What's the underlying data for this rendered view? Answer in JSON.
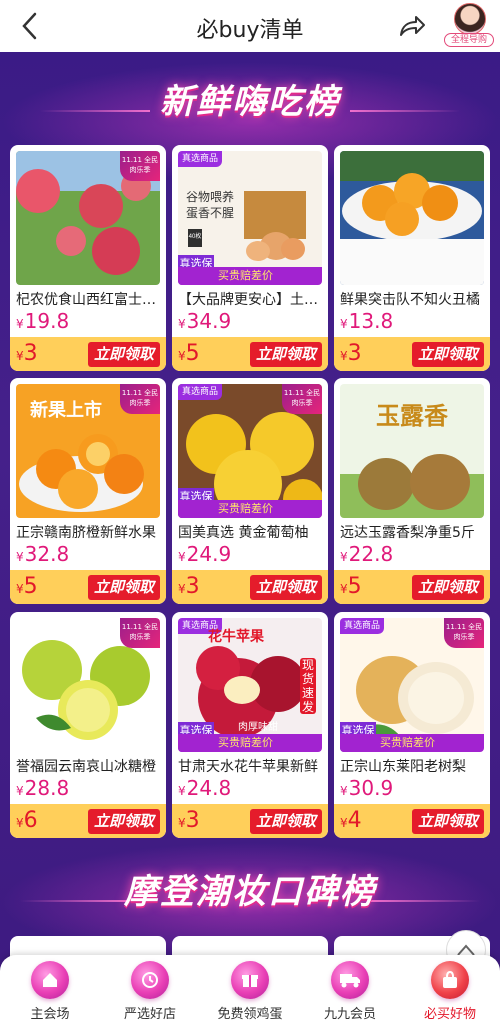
{
  "header": {
    "title": "必buy清单",
    "guide_label": "全程导购"
  },
  "sections": [
    {
      "title": "新鲜嗨吃榜"
    },
    {
      "title": "摩登潮妆口碑榜"
    }
  ],
  "coupon_button_label": "立即领取",
  "currency": "¥",
  "badge_text": "11.11 全民肉乐季",
  "tag_texts": {
    "strip": "真选商品",
    "foot_left": "真选保障",
    "foot_right": "买贵赔差价"
  },
  "products": [
    {
      "name": "杞农优食山西红富士苹果",
      "price": "19.8",
      "coupon": "3",
      "image": "red-apples"
    },
    {
      "name": "【大品牌更安心】土鸡蛋",
      "price": "34.9",
      "coupon": "5",
      "image": "egg-box"
    },
    {
      "name": "鲜果突击队不知火丑橘",
      "price": "13.8",
      "coupon": "3",
      "image": "oranges-bowl"
    },
    {
      "name": "正宗赣南脐橙新鲜水果",
      "price": "32.8",
      "coupon": "5",
      "image": "navel-oranges"
    },
    {
      "name": "国美真选 黄金葡萄柚",
      "price": "24.9",
      "coupon": "3",
      "image": "grapefruit"
    },
    {
      "name": "远达玉露香梨净重5斤",
      "price": "22.8",
      "coupon": "5",
      "image": "pears"
    },
    {
      "name": "誉福园云南哀山冰糖橙",
      "price": "28.8",
      "coupon": "6",
      "image": "limes"
    },
    {
      "name": "甘肃天水花牛苹果新鲜",
      "price": "24.8",
      "coupon": "3",
      "image": "red-apples-cut"
    },
    {
      "name": "正宗山东莱阳老树梨",
      "price": "30.9",
      "coupon": "4",
      "image": "asian-pear"
    }
  ],
  "image_texts": {
    "egg_box_line1": "谷物喂养",
    "egg_box_line2": "蛋香不腥",
    "egg_box_count": "40枚",
    "navel_banner": "新果上市",
    "pear_banner": "玉露香",
    "apple_banner": "花牛苹果",
    "apple_side": "现货速发",
    "apple_note": "肉厚味甜"
  },
  "nav": [
    {
      "label": "主会场",
      "icon": "home-icon",
      "active": false
    },
    {
      "label": "严选好店",
      "icon": "clock-icon",
      "active": false
    },
    {
      "label": "免费领鸡蛋",
      "icon": "gift-icon",
      "active": false
    },
    {
      "label": "九九会员",
      "icon": "truck-icon",
      "active": false
    },
    {
      "label": "必买好物",
      "icon": "bag-icon",
      "active": true
    }
  ],
  "colors": {
    "accent": "#e51c2b",
    "price": "#e0197a",
    "coupon_bar": "#ffcf5a",
    "background": "#3b1b86"
  }
}
